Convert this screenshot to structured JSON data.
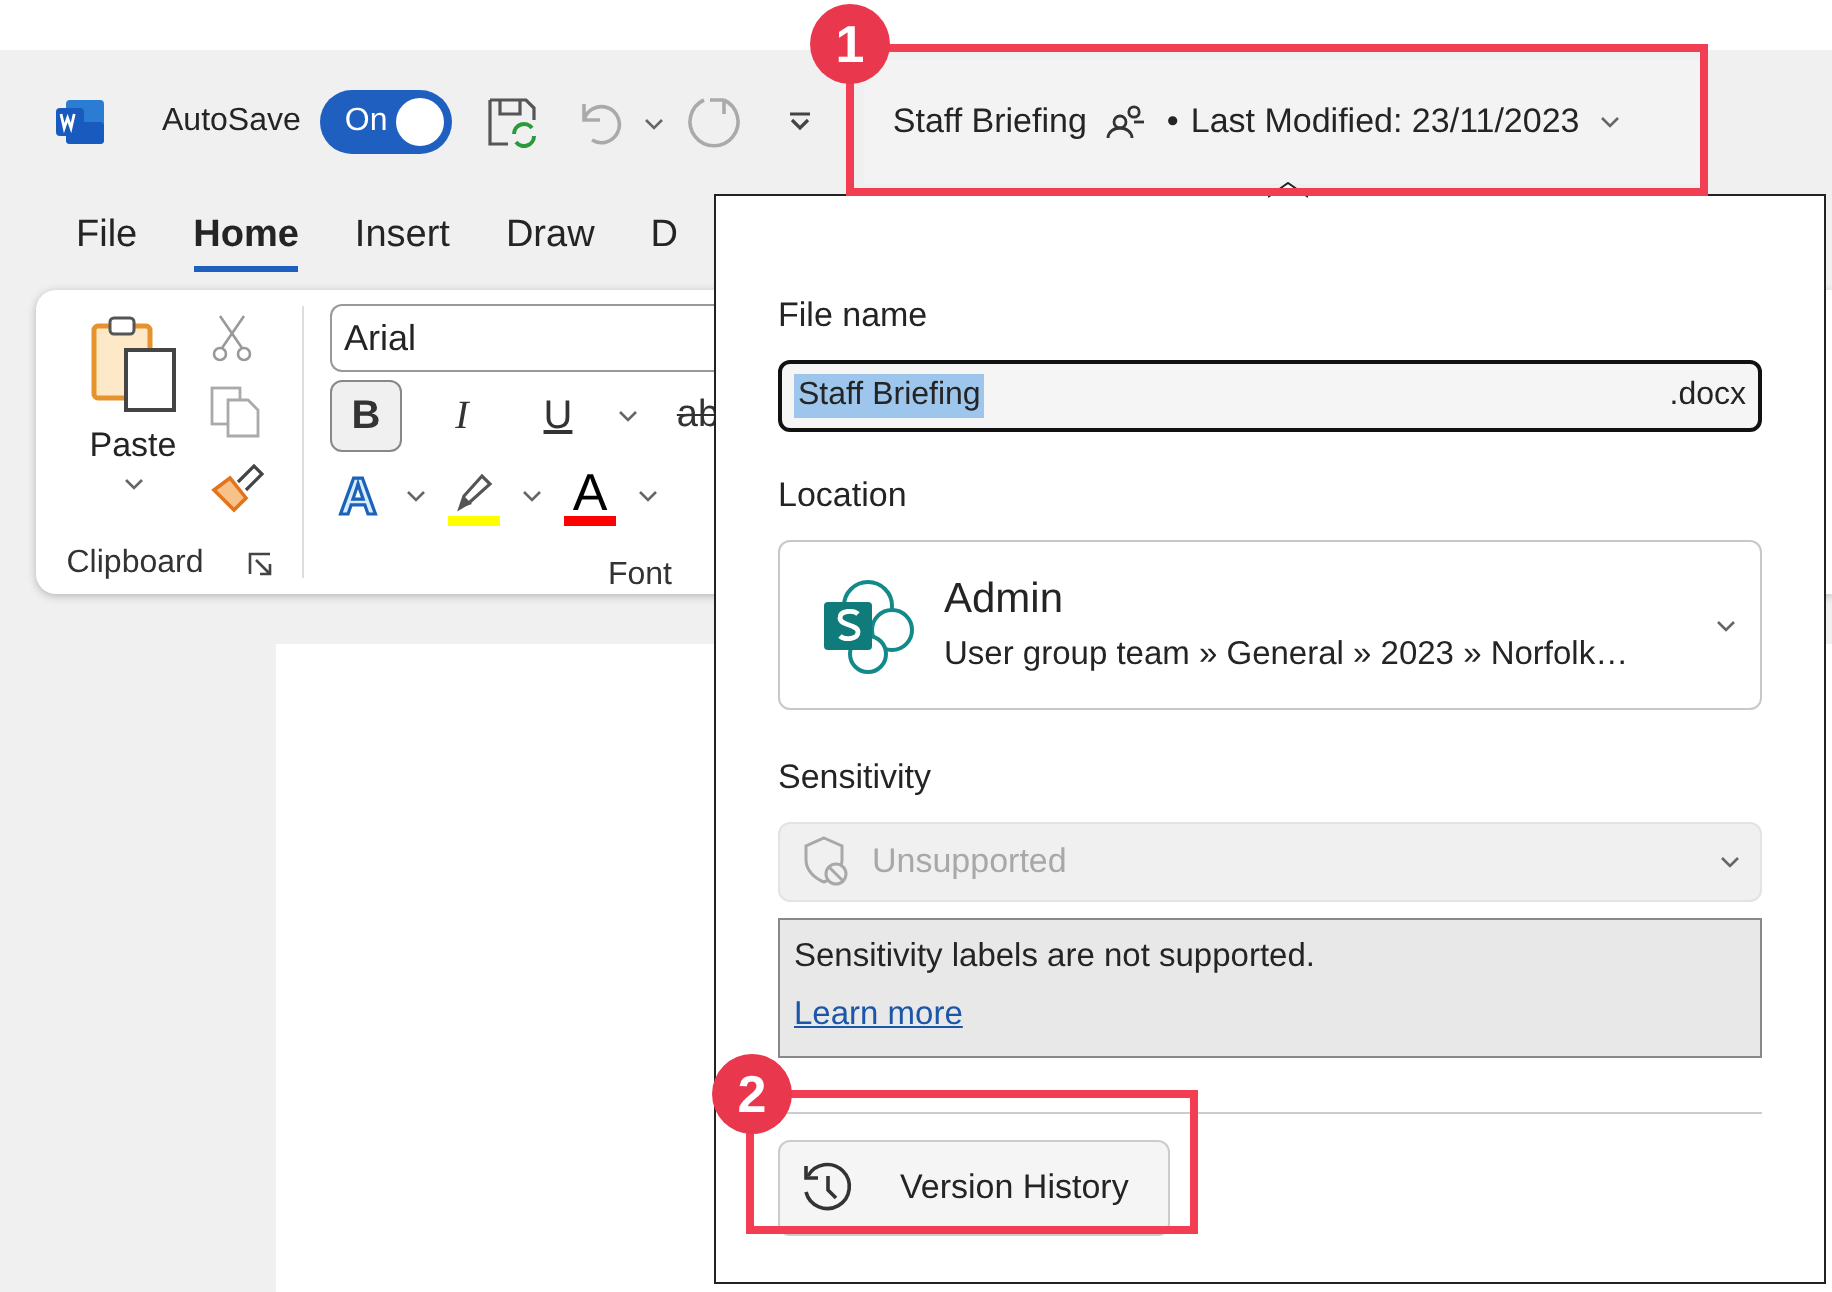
{
  "title_bar": {
    "autosave_label": "AutoSave",
    "autosave": {
      "label": "On",
      "on": true
    },
    "document_title": "Staff Briefing",
    "separator": "•",
    "last_modified": "Last Modified: 23/11/2023"
  },
  "tabs": [
    {
      "label": "File",
      "selected": false
    },
    {
      "label": "Home",
      "selected": true
    },
    {
      "label": "Insert",
      "selected": false
    },
    {
      "label": "Draw",
      "selected": false
    },
    {
      "label": "D",
      "selected": false
    }
  ],
  "ribbon": {
    "clipboard": {
      "paste_label": "Paste",
      "group_label": "Clipboard"
    },
    "font": {
      "font_name": "Arial",
      "group_label": "Font",
      "format_buttons": [
        {
          "kind": "bold",
          "glyph": "B",
          "selected": true,
          "dropdown": false
        },
        {
          "kind": "italic",
          "glyph": "I",
          "selected": false,
          "dropdown": false
        },
        {
          "kind": "underline",
          "glyph": "U",
          "selected": false,
          "dropdown": true
        },
        {
          "kind": "strikethrough",
          "glyph": "ab",
          "selected": false,
          "dropdown": false
        }
      ],
      "color_buttons": [
        {
          "kind": "text_effects",
          "glyph": "A"
        },
        {
          "kind": "highlight",
          "color": "#ffff00"
        },
        {
          "kind": "font_color",
          "glyph": "A",
          "color": "#ff0000"
        }
      ]
    }
  },
  "file_panel": {
    "file_name_label": "File name",
    "file_name": {
      "value": "Staff Briefing",
      "selected": true
    },
    "extension": ".docx",
    "location_label": "Location",
    "location": {
      "name": "Admin",
      "path": "User group team » General » 2023 » Norfolk…"
    },
    "sensitivity_label": "Sensitivity",
    "sensitivity": {
      "value": "Unsupported",
      "disabled": true
    },
    "notice": {
      "text": "Sensitivity labels are not supported.",
      "link": "Learn more"
    },
    "version_history": "Version History"
  },
  "annotations": [
    {
      "number": "1"
    },
    {
      "number": "2"
    }
  ]
}
